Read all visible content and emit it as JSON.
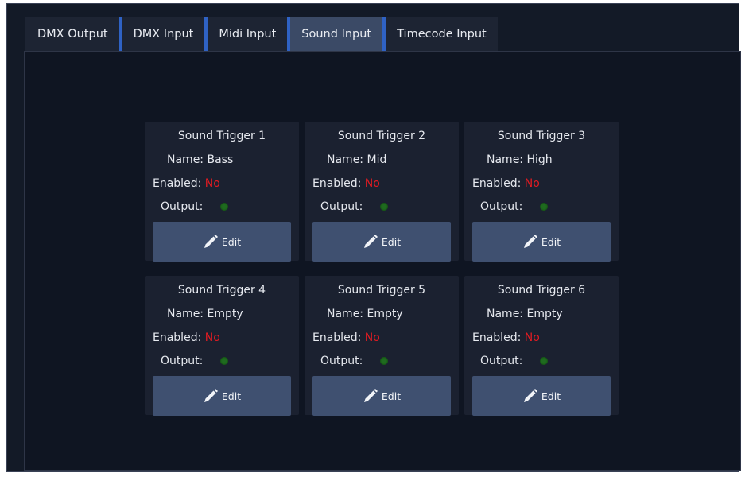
{
  "tabs": [
    {
      "label": "DMX Output"
    },
    {
      "label": "DMX Input"
    },
    {
      "label": "Midi Input"
    },
    {
      "label": "Sound Input"
    },
    {
      "label": "Timecode Input"
    }
  ],
  "active_tab": "Sound Input",
  "labels": {
    "name_prefix": "Name: ",
    "enabled_label": "Enabled: ",
    "output_label": "Output:",
    "edit_label": "Edit"
  },
  "triggers": [
    {
      "title": "Sound Trigger 1",
      "name": "Bass",
      "enabled": "No",
      "output_led": "off"
    },
    {
      "title": "Sound Trigger 2",
      "name": "Mid",
      "enabled": "No",
      "output_led": "off"
    },
    {
      "title": "Sound Trigger 3",
      "name": "High",
      "enabled": "No",
      "output_led": "off"
    },
    {
      "title": "Sound Trigger 4",
      "name": "Empty",
      "enabled": "No",
      "output_led": "off"
    },
    {
      "title": "Sound Trigger 5",
      "name": "Empty",
      "enabled": "No",
      "output_led": "off"
    },
    {
      "title": "Sound Trigger 6",
      "name": "Empty",
      "enabled": "No",
      "output_led": "off"
    }
  ],
  "colors": {
    "background": "#131a27",
    "tab_accent": "#2f62c4",
    "active_tab": "#3b4a66",
    "card": "#1b2130",
    "button": "#3f5070",
    "enabled_no": "#e11b22",
    "led_off": "#1f6b1f"
  },
  "icons": {
    "edit": "pencil-icon",
    "output": "status-led-icon"
  }
}
